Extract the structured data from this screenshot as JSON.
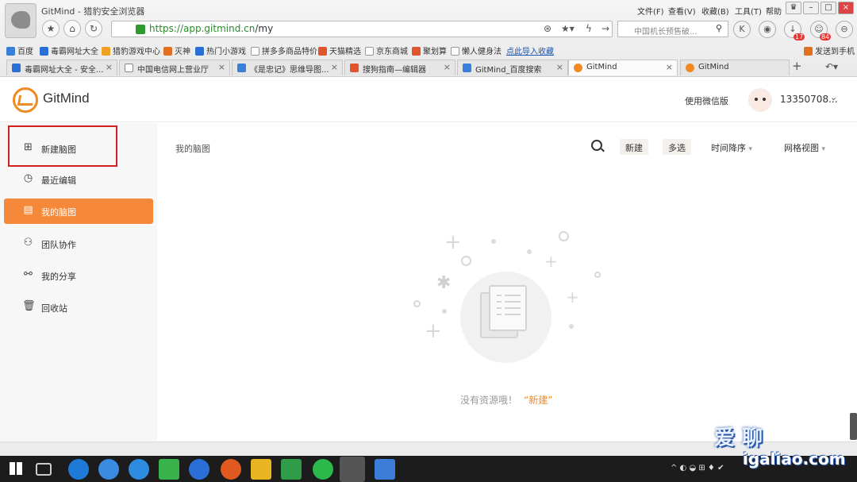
{
  "window": {
    "title": "GitMind - 猎豹安全浏览器",
    "menu": [
      "文件(F)",
      "查看(V)",
      "收藏(B)",
      "工具(T)",
      "帮助"
    ]
  },
  "address_bar": {
    "scheme": "https://",
    "host": "app.gitmind.cn",
    "path": "/my"
  },
  "search_box": {
    "placeholder": "中国机长预售破..."
  },
  "badges": {
    "download": "17",
    "chat": "84"
  },
  "bookmarks": [
    "百度",
    "毒霸网址大全",
    "猎豹游戏中心",
    "灭神",
    "热门小游戏",
    "拼多多商品特价",
    "天猫精选",
    "京东商城",
    "聚划算",
    "懒人健身法",
    "点此导入收藏"
  ],
  "bookmarks_right": "发送到手机",
  "tabs": [
    {
      "label": "毒霸网址大全 - 安全...",
      "color": "#2a6fd6"
    },
    {
      "label": "中国电信网上营业厅",
      "color": "#777"
    },
    {
      "label": "《是忠记》思维导图...",
      "color": "#3a7fd8"
    },
    {
      "label": "搜狗指南—编辑器",
      "color": "#e0552b"
    },
    {
      "label": "GitMind_百度搜索",
      "color": "#3a7fd8"
    },
    {
      "label": "GitMind",
      "color": "#f08a24"
    },
    {
      "label": "GitMind",
      "color": "#f08a24"
    }
  ],
  "app": {
    "name": "GitMind",
    "wechat_link": "使用微信版",
    "username": "13350708...",
    "main_title": "我的脑图",
    "toolbar": {
      "new": "新建",
      "multi": "多选",
      "sort": "时间降序",
      "view": "网格视图"
    },
    "sidebar": [
      "新建脑图",
      "最近编辑",
      "我的脑图",
      "团队协作",
      "我的分享",
      "回收站"
    ],
    "empty_text": "没有资源哦！",
    "empty_link": "“新建”"
  },
  "watermark": {
    "line1": "爱 聊",
    "line2": "igaliao.com"
  },
  "colors": {
    "accent": "#f6883a",
    "highlight_box": "#d22020"
  },
  "icons": [
    "new-map-icon",
    "clock-icon",
    "doc-icon",
    "team-icon",
    "share-icon",
    "trash-icon",
    "search-icon"
  ]
}
